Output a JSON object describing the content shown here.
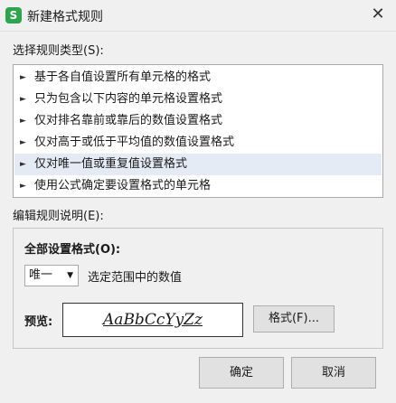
{
  "window": {
    "icon_letter": "S",
    "title": "新建格式规则",
    "close_symbol": "✕"
  },
  "rule_type": {
    "label": "选择规则类型(S):",
    "items": [
      {
        "label": "基于各自值设置所有单元格的格式"
      },
      {
        "label": "只为包含以下内容的单元格设置格式"
      },
      {
        "label": "仅对排名靠前或靠后的数值设置格式"
      },
      {
        "label": "仅对高于或低于平均值的数值设置格式"
      },
      {
        "label": "仅对唯一值或重复值设置格式"
      },
      {
        "label": "使用公式确定要设置格式的单元格"
      }
    ],
    "selected_index": 4,
    "arrow_symbol": "►"
  },
  "description": {
    "label": "编辑规则说明(E):",
    "format_all_label": "全部设置格式(O):",
    "dropdown_value": "唯一",
    "dropdown_arrow": "▼",
    "dropdown_caption": "选定范围中的数值",
    "preview_label": "预览:",
    "preview_text": "AaBbCcYyZz",
    "format_button": "格式(F)..."
  },
  "buttons": {
    "ok": "确定",
    "cancel": "取消"
  },
  "colors": {
    "app_icon": "#2da44e",
    "selected_row": "#e4ebf4"
  }
}
